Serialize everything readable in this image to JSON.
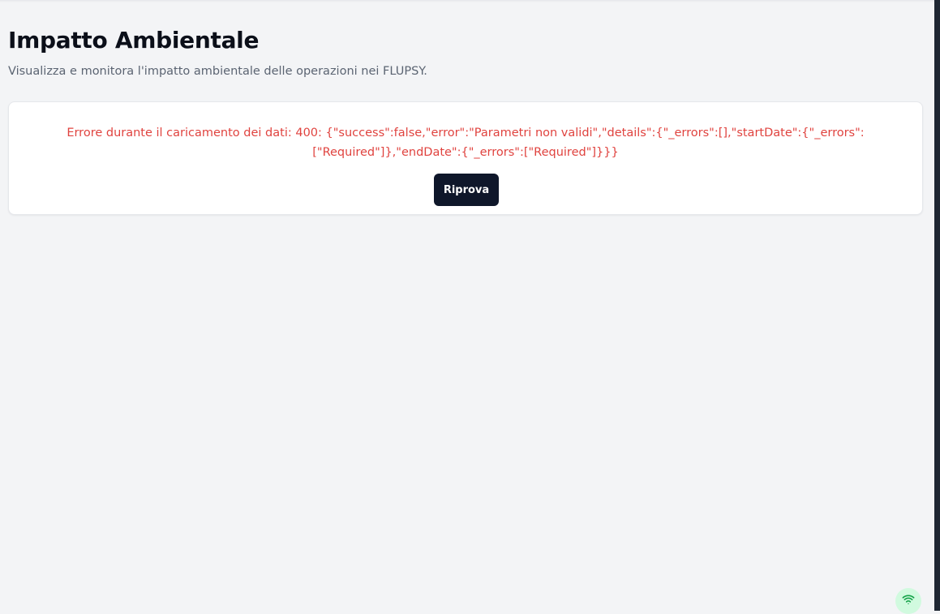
{
  "page": {
    "title": "Impatto Ambientale",
    "subtitle": "Visualizza e monitora l'impatto ambientale delle operazioni nei FLUPSY."
  },
  "error_card": {
    "message": "Errore durante il caricamento dei dati: 400: {\"success\":false,\"error\":\"Parametri non validi\",\"details\":{\"_errors\":[],\"startDate\":{\"_errors\":[\"Required\"]},\"endDate\":{\"_errors\":[\"Required\"]}}}",
    "retry_label": "Riprova"
  },
  "status": {
    "connection_icon": "wifi-icon",
    "connection_color": "#16a34a"
  },
  "colors": {
    "error_text": "#e0433f",
    "primary_button": "#0f172a",
    "background": "#f3f4f6"
  }
}
